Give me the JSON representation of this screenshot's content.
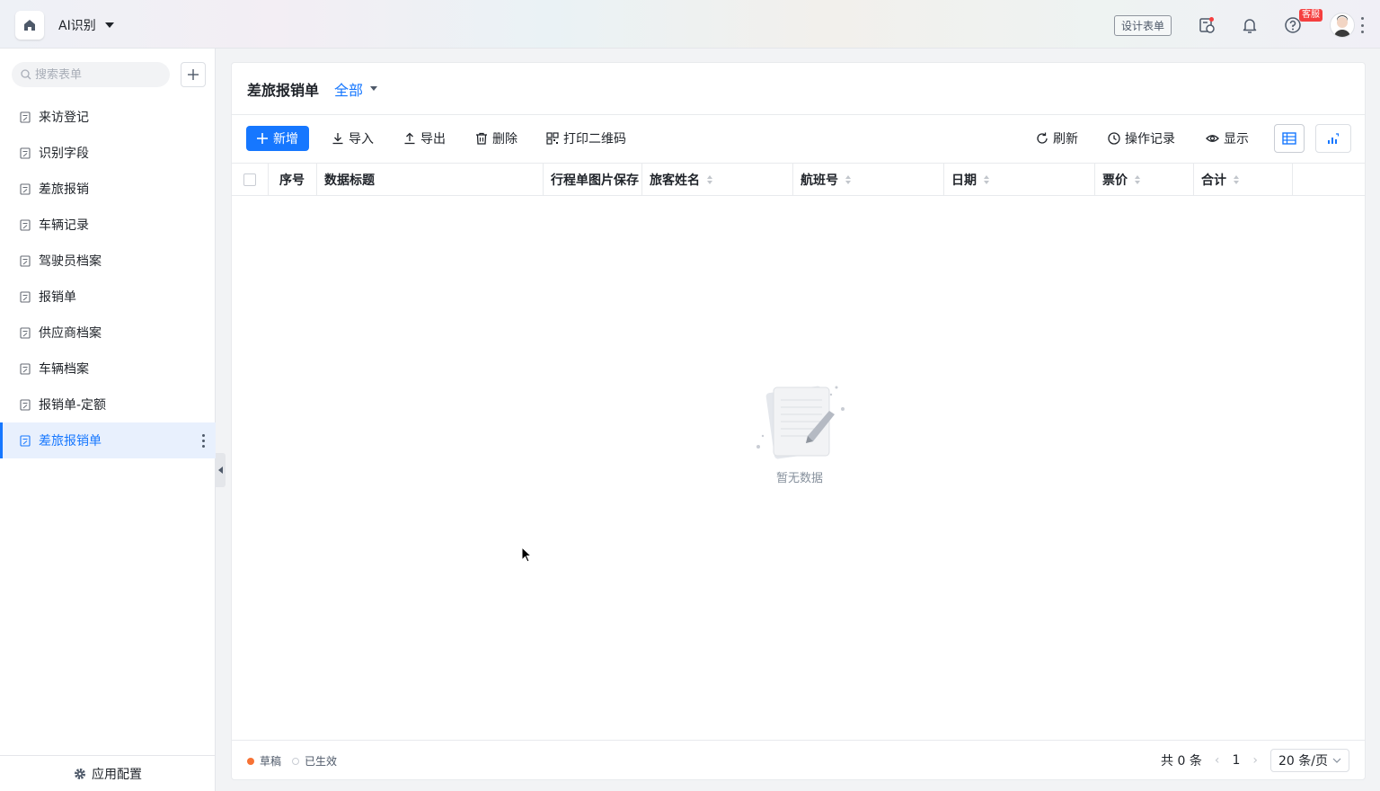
{
  "topbar": {
    "app_title": "AI识别",
    "design_button": "设计表单",
    "support_badge": "客服"
  },
  "sidebar": {
    "search_placeholder": "搜索表单",
    "items": [
      {
        "label": "来访登记"
      },
      {
        "label": "识别字段"
      },
      {
        "label": "差旅报销"
      },
      {
        "label": "车辆记录"
      },
      {
        "label": "驾驶员档案"
      },
      {
        "label": "报销单"
      },
      {
        "label": "供应商档案"
      },
      {
        "label": "车辆档案"
      },
      {
        "label": "报销单-定额"
      },
      {
        "label": "差旅报销单"
      }
    ],
    "active_index": 9,
    "footer_label": "应用配置"
  },
  "main": {
    "title": "差旅报销单",
    "filter_label": "全部",
    "toolbar": {
      "add": "新增",
      "import": "导入",
      "export": "导出",
      "delete": "删除",
      "print_qr": "打印二维码",
      "refresh": "刷新",
      "history": "操作记录",
      "display": "显示"
    },
    "columns": [
      {
        "label": "序号",
        "sortable": false
      },
      {
        "label": "数据标题",
        "sortable": false
      },
      {
        "label": "行程单图片保存",
        "sortable": false
      },
      {
        "label": "旅客姓名",
        "sortable": true
      },
      {
        "label": "航班号",
        "sortable": true
      },
      {
        "label": "日期",
        "sortable": true
      },
      {
        "label": "票价",
        "sortable": true
      },
      {
        "label": "合计",
        "sortable": true
      }
    ],
    "empty_text": "暂无数据",
    "footer": {
      "legend_draft": "草稿",
      "legend_active": "已生效",
      "total": "共 0 条",
      "current_page": "1",
      "page_size": "20 条/页"
    }
  },
  "colors": {
    "accent": "#1677ff",
    "draft_dot": "#f77234",
    "badge": "#f53f3f"
  }
}
